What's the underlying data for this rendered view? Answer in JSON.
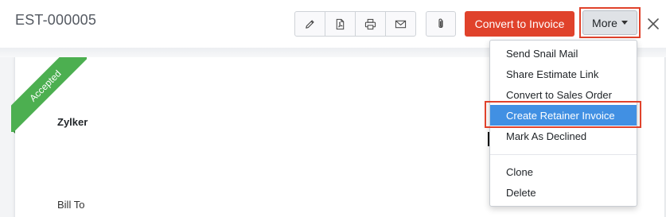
{
  "header": {
    "title": "EST-000005",
    "convert_label": "Convert to Invoice",
    "more_label": "More",
    "icons": [
      "pencil-icon",
      "pdf-icon",
      "print-icon",
      "mail-icon",
      "paperclip-icon",
      "close-icon"
    ]
  },
  "document": {
    "status": "Accepted",
    "status_color": "#4caf50",
    "company": "Zylker",
    "bill_to_label": "Bill To"
  },
  "menu": {
    "items": [
      {
        "label": "Send Snail Mail"
      },
      {
        "label": "Share Estimate Link"
      },
      {
        "label": "Convert to Sales Order"
      },
      {
        "label": "Create Retainer Invoice"
      },
      {
        "label": "Mark As Declined"
      },
      {
        "label": "Clone"
      },
      {
        "label": "Delete"
      }
    ],
    "active_item": "Create Retainer Invoice"
  },
  "colors": {
    "accent": "#e0422b",
    "menu_highlight": "#4190e3"
  }
}
